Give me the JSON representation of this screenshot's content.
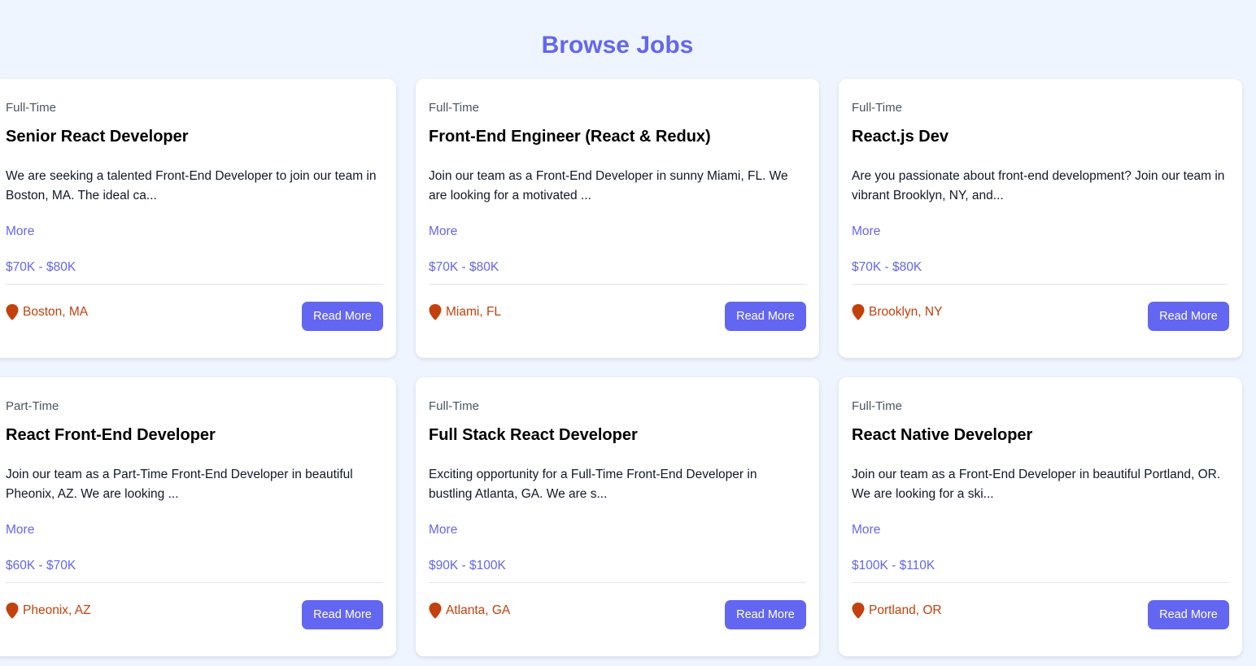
{
  "page": {
    "title": "Browse Jobs"
  },
  "colors": {
    "accent": "#6366f1",
    "location": "#c2410c",
    "background": "#eef5ff"
  },
  "jobs": [
    {
      "type": "Full-Time",
      "title": "Senior React Developer",
      "description": "We are seeking a talented Front-End Developer to join our team in Boston, MA. The ideal ca...",
      "more_label": "More",
      "salary": "$70K - $80K",
      "location": "Boston, MA",
      "button_label": "Read More",
      "location_icon": "map-pin-icon"
    },
    {
      "type": "Full-Time",
      "title": "Front-End Engineer (React & Redux)",
      "description": "Join our team as a Front-End Developer in sunny Miami, FL. We are looking for a motivated ...",
      "more_label": "More",
      "salary": "$70K - $80K",
      "location": "Miami, FL",
      "button_label": "Read More",
      "location_icon": "map-pin-icon"
    },
    {
      "type": "Full-Time",
      "title": "React.js Dev",
      "description": "Are you passionate about front-end development? Join our team in vibrant Brooklyn, NY, and...",
      "more_label": "More",
      "salary": "$70K - $80K",
      "location": "Brooklyn, NY",
      "button_label": "Read More",
      "location_icon": "map-pin-icon"
    },
    {
      "type": "Part-Time",
      "title": "React Front-End Developer",
      "description": "Join our team as a Part-Time Front-End Developer in beautiful Pheonix, AZ. We are looking ...",
      "more_label": "More",
      "salary": "$60K - $70K",
      "location": "Pheonix, AZ",
      "button_label": "Read More",
      "location_icon": "map-pin-icon"
    },
    {
      "type": "Full-Time",
      "title": "Full Stack React Developer",
      "description": "Exciting opportunity for a Full-Time Front-End Developer in bustling Atlanta, GA. We are s...",
      "more_label": "More",
      "salary": "$90K - $100K",
      "location": "Atlanta, GA",
      "button_label": "Read More",
      "location_icon": "map-pin-icon"
    },
    {
      "type": "Full-Time",
      "title": "React Native Developer",
      "description": "Join our team as a Front-End Developer in beautiful Portland, OR. We are looking for a ski...",
      "more_label": "More",
      "salary": "$100K - $110K",
      "location": "Portland, OR",
      "button_label": "Read More",
      "location_icon": "map-pin-icon"
    }
  ]
}
